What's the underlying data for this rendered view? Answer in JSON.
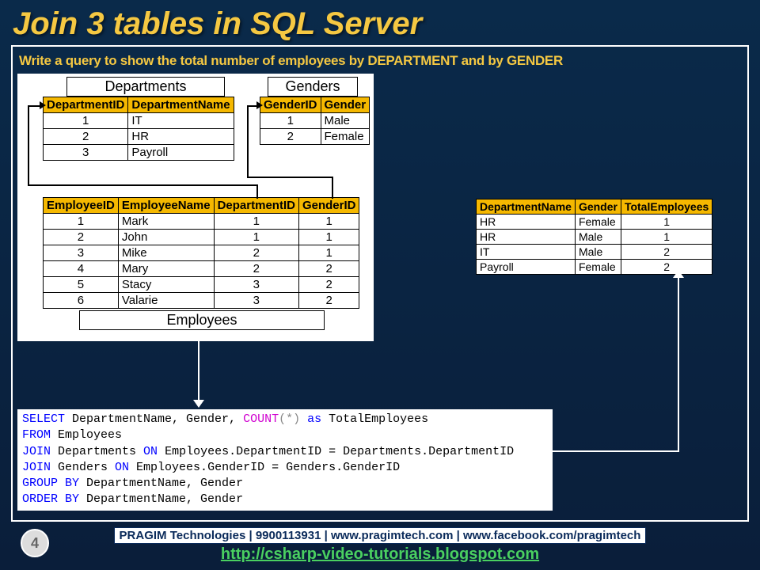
{
  "title": "Join 3 tables in SQL Server",
  "subtitle": "Write a query to show the total number of employees by DEPARTMENT and by GENDER",
  "tables": {
    "departments": {
      "label": "Departments",
      "cols": [
        "DepartmentID",
        "DepartmentName"
      ],
      "rows": [
        [
          "1",
          "IT"
        ],
        [
          "2",
          "HR"
        ],
        [
          "3",
          "Payroll"
        ]
      ]
    },
    "genders": {
      "label": "Genders",
      "cols": [
        "GenderID",
        "Gender"
      ],
      "rows": [
        [
          "1",
          "Male"
        ],
        [
          "2",
          "Female"
        ]
      ]
    },
    "employees": {
      "label": "Employees",
      "cols": [
        "EmployeeID",
        "EmployeeName",
        "DepartmentID",
        "GenderID"
      ],
      "rows": [
        [
          "1",
          "Mark",
          "1",
          "1"
        ],
        [
          "2",
          "John",
          "1",
          "1"
        ],
        [
          "3",
          "Mike",
          "2",
          "1"
        ],
        [
          "4",
          "Mary",
          "2",
          "2"
        ],
        [
          "5",
          "Stacy",
          "3",
          "2"
        ],
        [
          "6",
          "Valarie",
          "3",
          "2"
        ]
      ]
    }
  },
  "result": {
    "cols": [
      "DepartmentName",
      "Gender",
      "TotalEmployees"
    ],
    "rows": [
      [
        "HR",
        "Female",
        "1"
      ],
      [
        "HR",
        "Male",
        "1"
      ],
      [
        "IT",
        "Male",
        "2"
      ],
      [
        "Payroll",
        "Female",
        "2"
      ]
    ]
  },
  "sql": {
    "t1a": "SELECT",
    "t1b": " DepartmentName, Gender, ",
    "t1c": "COUNT",
    "t1d": "(*)",
    "t1e": " as",
    "t1f": " TotalEmployees",
    "t2a": "FROM",
    "t2b": " Employees",
    "t3a": "JOIN",
    "t3b": " Departments ",
    "t3c": "ON",
    "t3d": " Employees.DepartmentID = Departments.DepartmentID",
    "t4a": "JOIN",
    "t4b": " Genders ",
    "t4c": "ON",
    "t4d": " Employees.GenderID = Genders.GenderID",
    "t5a": "GROUP",
    "t5b": " BY",
    "t5c": " DepartmentName, Gender",
    "t6a": "ORDER",
    "t6b": " BY",
    "t6c": " DepartmentName, Gender"
  },
  "footer": {
    "box": "PRAGIM Technologies | 9900113931 | www.pragimtech.com | www.facebook.com/pragimtech",
    "link": "http://csharp-video-tutorials.blogspot.com"
  },
  "slide_number": "4"
}
